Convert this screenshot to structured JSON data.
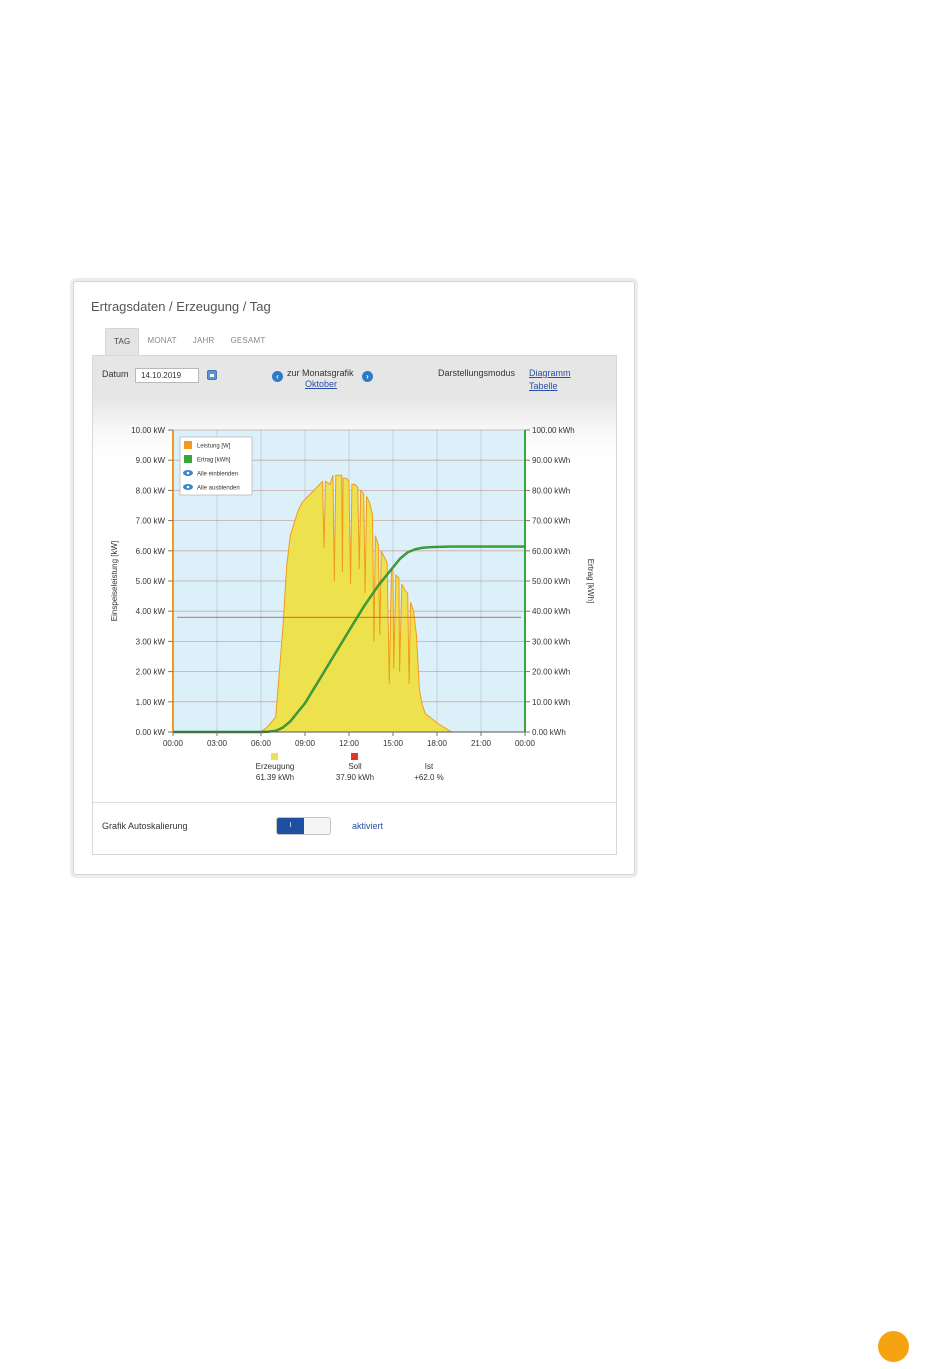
{
  "panel": {
    "title": "Ertragsdaten / Erzeugung / Tag"
  },
  "tabs": [
    "TAG",
    "MONAT",
    "JAHR",
    "GESAMT"
  ],
  "active_tab": "TAG",
  "toolbar": {
    "date_label": "Datum",
    "date_value": "14.10.2019",
    "calendar_icon": "calendar-icon",
    "prev_icon": "chevron-left-icon",
    "next_icon": "chevron-right-icon",
    "month_nav_label": "zur Monatsgrafik",
    "month_link": "Oktober",
    "mode_label": "Darstellungsmodus",
    "mode_diagram": "Diagramm",
    "mode_table": "Tabelle"
  },
  "chart_data": {
    "type": "area",
    "xlabel": "",
    "ylabel_left": "Einspeiseleistung [kW]",
    "ylabel_right": "Ertrag [kWh]",
    "x_ticks": [
      "00:00",
      "03:00",
      "06:00",
      "09:00",
      "12:00",
      "15:00",
      "18:00",
      "21:00",
      "00:00"
    ],
    "y_left_ticks": [
      "0.00 kW",
      "1.00 kW",
      "2.00 kW",
      "3.00 kW",
      "4.00 kW",
      "5.00 kW",
      "6.00 kW",
      "7.00 kW",
      "8.00 kW",
      "9.00 kW",
      "10.00 kW"
    ],
    "y_right_ticks": [
      "0.00 kWh",
      "10.00 kWh",
      "20.00 kWh",
      "30.00 kWh",
      "40.00 kWh",
      "50.00 kWh",
      "60.00 kWh",
      "70.00 kWh",
      "80.00 kWh",
      "90.00 kWh",
      "100.00 kWh"
    ],
    "ylim_left": [
      0,
      10
    ],
    "ylim_right": [
      0,
      100
    ],
    "xlim_hours": [
      0,
      24
    ],
    "grid": true,
    "legend_position": "top-left",
    "legend": [
      {
        "label": "Leistung [W]",
        "color": "#f39a1e",
        "icon": "square"
      },
      {
        "label": "Ertrag [kWh]",
        "color": "#3aa63a",
        "icon": "square"
      },
      {
        "label": "Alle einblenden",
        "color": "#3a87c8",
        "icon": "eye-icon"
      },
      {
        "label": "Alle ausblenden",
        "color": "#3a87c8",
        "icon": "eye-slash-icon"
      }
    ],
    "soll_line_kw": 3.8,
    "series": [
      {
        "name": "Leistung [W]",
        "axis": "left",
        "color": "#f39a1e",
        "fill": "#ede24e",
        "x_hours": [
          0,
          6.0,
          6.5,
          7.0,
          7.5,
          7.75,
          8.0,
          8.5,
          8.8,
          9.2,
          9.6,
          10.0,
          10.2,
          10.3,
          10.4,
          10.7,
          10.9,
          11.0,
          11.1,
          11.3,
          11.5,
          11.55,
          11.6,
          11.8,
          12.0,
          12.1,
          12.2,
          12.4,
          12.6,
          12.7,
          12.8,
          13.0,
          13.1,
          13.2,
          13.4,
          13.6,
          13.7,
          13.8,
          14.0,
          14.1,
          14.2,
          14.4,
          14.6,
          14.75,
          14.9,
          15.0,
          15.05,
          15.2,
          15.4,
          15.45,
          15.6,
          15.8,
          16.0,
          16.1,
          16.2,
          16.4,
          16.6,
          16.8,
          17.0,
          17.2,
          17.5,
          18.0,
          18.5,
          19.0,
          24
        ],
        "values": [
          0,
          0,
          0.2,
          0.5,
          3.5,
          5.5,
          6.5,
          7.3,
          7.6,
          7.8,
          8.0,
          8.2,
          8.3,
          6.1,
          8.3,
          8.2,
          8.5,
          5.0,
          8.5,
          8.5,
          8.5,
          5.3,
          8.4,
          8.4,
          8.3,
          4.9,
          8.2,
          8.2,
          8.1,
          5.4,
          8.0,
          7.9,
          4.6,
          7.8,
          7.6,
          7.2,
          3.0,
          6.5,
          6.2,
          3.2,
          6.0,
          5.8,
          5.6,
          1.6,
          5.4,
          5.3,
          2.1,
          5.2,
          5.1,
          2.0,
          4.9,
          4.7,
          4.6,
          1.6,
          4.3,
          4.0,
          3.2,
          1.4,
          0.9,
          0.6,
          0.5,
          0.3,
          0.15,
          0,
          0
        ]
      },
      {
        "name": "Ertrag [kWh]",
        "axis": "right",
        "color": "#3aa63a",
        "x_hours": [
          0,
          6.0,
          6.5,
          7.0,
          7.5,
          8.0,
          9.0,
          10.0,
          11.0,
          12.0,
          13.0,
          14.0,
          15.0,
          15.5,
          16.0,
          16.5,
          17.0,
          17.5,
          18.0,
          19.0,
          20.0,
          24
        ],
        "values": [
          0,
          0,
          0.1,
          0.4,
          1.5,
          3.5,
          9.5,
          17.5,
          25.5,
          33.5,
          41.5,
          48.5,
          54.5,
          57.5,
          59.5,
          60.5,
          61.0,
          61.2,
          61.3,
          61.39,
          61.39,
          61.39
        ]
      }
    ],
    "summary": [
      {
        "label": "Erzeugung",
        "value": "61.39 kWh",
        "color": "#ede24e"
      },
      {
        "label": "Soll",
        "value": "37.90 kWh",
        "color": "#e8332a"
      },
      {
        "label": "Ist",
        "value": "+62.0 %",
        "color": ""
      }
    ]
  },
  "autoscale": {
    "label": "Grafik Autoskalierung",
    "toggle_text": "I",
    "status": "aktiviert"
  }
}
